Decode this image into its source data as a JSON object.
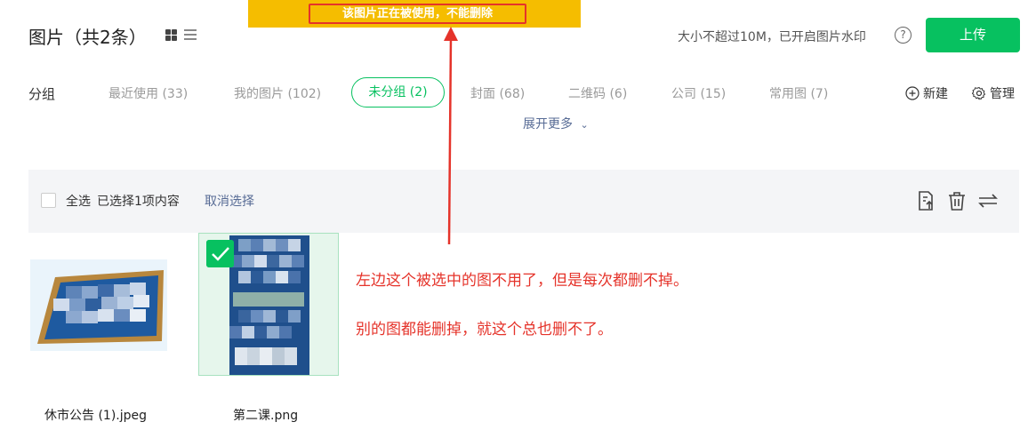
{
  "toast": {
    "text": "该图片正在被使用，不能删除"
  },
  "header": {
    "title": "图片（共2条）",
    "upload_info": "大小不超过10M，已开启图片水印",
    "help": "?",
    "upload_label": "上传"
  },
  "groups": {
    "label": "分组",
    "tabs": [
      {
        "label": "最近使用 (33)"
      },
      {
        "label": "我的图片 (102)"
      },
      {
        "label": "未分组 (2)"
      },
      {
        "label": "封面 (68)"
      },
      {
        "label": "二维码 (6)"
      },
      {
        "label": "公司 (15)"
      },
      {
        "label": "常用图 (7)"
      }
    ],
    "active_index": 2,
    "new_label": "新建",
    "manage_label": "管理",
    "expand_label": "展开更多"
  },
  "selection": {
    "select_all": "全选",
    "selected_count": "已选择1项内容",
    "cancel": "取消选择",
    "tools": [
      "move-to-group-icon",
      "trash-icon",
      "swap-icon"
    ]
  },
  "images": [
    {
      "name": "休市公告 (1).jpeg",
      "selected": false
    },
    {
      "name": "第二课.png",
      "selected": true
    }
  ],
  "annotations": [
    "左边这个被选中的图不用了，但是每次都删不掉。",
    "别的图都能删掉，就这个总也删不了。"
  ],
  "colors": {
    "accent": "#07c160",
    "toast": "#f5bd00",
    "annotation": "#e5332a",
    "link": "#576b95"
  }
}
